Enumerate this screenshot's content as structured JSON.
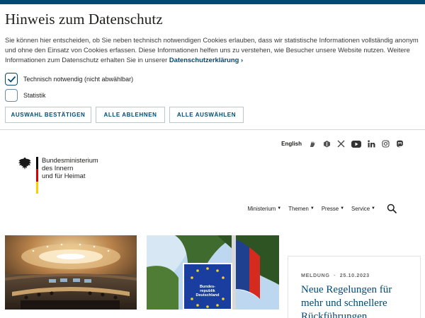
{
  "cookie_banner": {
    "title": "Hinweis zum Datenschutz",
    "text": "Sie können hier entscheiden, ob Sie neben technisch notwendigen Cookies erlauben, dass wir statistische Informationen vollständig anonym und ohne den Einsatz von Cookies erfassen. Diese Informationen helfen uns zu verstehen, wie Besucher unsere Website nutzen. Weitere Informationen zum Datenschutz erhalten Sie in unserer ",
    "link_label": "Datenschutzerklärung",
    "options": [
      {
        "label": "Technisch notwendig (nicht abwählbar)",
        "checked": true
      },
      {
        "label": "Statistik",
        "checked": false
      }
    ],
    "buttons": {
      "confirm": "AUSWAHL BESTÄTIGEN",
      "reject": "ALLE ABLEHNEN",
      "accept": "ALLE AUSWÄHLEN"
    }
  },
  "header": {
    "language_link": "English",
    "social_icons": [
      "sign-language-icon",
      "plain-language-icon",
      "x-icon",
      "youtube-icon",
      "linkedin-icon",
      "instagram-icon",
      "mastodon-icon"
    ],
    "logo": {
      "line1": "Bundesministerium",
      "line2": "des Innern",
      "line3": "und für Heimat"
    },
    "nav": [
      "Ministerium",
      "Themen",
      "Presse",
      "Service"
    ]
  },
  "teaser_images": [
    {
      "icon": "conference-hall-image"
    },
    {
      "icon": "border-sign-image",
      "sign_text": [
        "Bundes-",
        "republik",
        "Deutschland"
      ]
    }
  ],
  "news": {
    "category": "MELDUNG",
    "separator": "·",
    "date": "25.10.2023",
    "title": "Neue Regelungen für mehr und schnellere Rückführungen"
  },
  "colors": {
    "brand_blue": "#004b76",
    "flag_black": "#000000",
    "flag_red": "#dd0000",
    "flag_gold": "#ffcc00"
  }
}
